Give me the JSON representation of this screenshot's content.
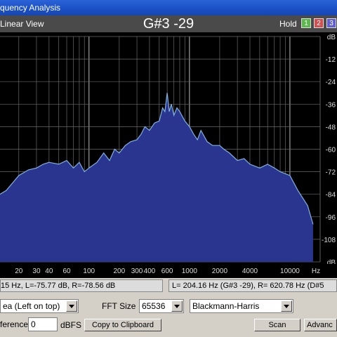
{
  "window": {
    "title": "quency Analysis"
  },
  "viewbar": {
    "view_label": "Linear View",
    "note": "G#3 -29",
    "hold_label": "Hold",
    "hold_buttons": [
      {
        "label": "1",
        "color": "#5cb84c"
      },
      {
        "label": "2",
        "color": "#d05050"
      },
      {
        "label": "3",
        "color": "#6060d0"
      }
    ]
  },
  "chart_data": {
    "type": "area",
    "xscale": "log",
    "xlim": [
      13,
      20000
    ],
    "ylim": [
      -120,
      0
    ],
    "x_tick_labels": [
      "20",
      "30",
      "40",
      "60",
      "100",
      "200",
      "300",
      "400",
      "600",
      "1000",
      "2000",
      "4000",
      "10000",
      "Hz"
    ],
    "y_tick_labels": [
      "dB",
      "-12",
      "-24",
      "-36",
      "-48",
      "-60",
      "-72",
      "-84",
      "-96",
      "-108",
      "dB"
    ],
    "grid": true,
    "fill_color": "#2a3590",
    "line_color": "#7fb2e0",
    "series": [
      {
        "x": [
          13,
          15,
          20,
          25,
          30,
          35,
          40,
          50,
          60,
          70,
          80,
          90,
          100,
          120,
          140,
          160,
          180,
          200,
          230,
          260,
          300,
          330,
          360,
          400,
          450,
          500,
          540,
          570,
          600,
          630,
          660,
          700,
          750,
          800,
          900,
          1000,
          1100,
          1200,
          1300,
          1500,
          1700,
          2000,
          2200,
          2500,
          3000,
          3500,
          4000,
          5000,
          6000,
          7000,
          8000,
          10000,
          12000,
          15000,
          17000
        ],
        "y": [
          -84,
          -82,
          -74,
          -71,
          -70,
          -68,
          -67,
          -68,
          -66,
          -70,
          -67,
          -72,
          -70,
          -67,
          -62,
          -66,
          -60,
          -62,
          -58,
          -56,
          -55,
          -52,
          -48,
          -50,
          -46,
          -45,
          -38,
          -40,
          -30,
          -40,
          -36,
          -42,
          -38,
          -40,
          -45,
          -48,
          -52,
          -55,
          -50,
          -56,
          -58,
          -58,
          -60,
          -62,
          -66,
          -65,
          -68,
          -70,
          -68,
          -70,
          -72,
          -74,
          -82,
          -90,
          -100
        ]
      }
    ]
  },
  "status": {
    "cursor_readout": "15 Hz, L=-75.77 dB, R=-78.56 dB",
    "range_readout": "L= 204.16 Hz (G#3 -29), R= 620.78 Hz (D#5"
  },
  "controls": {
    "display_mode": "ea (Left on top)",
    "fft_size_label": "FFT Size",
    "fft_size_value": "65536",
    "window_function": "Blackmann-Harris",
    "reference_label": "ference",
    "reference_value": "0",
    "reference_unit": "dBFS",
    "copy_button": "Copy to Clipboard",
    "scan_button": "Scan",
    "advanced_button": "Advanc"
  }
}
